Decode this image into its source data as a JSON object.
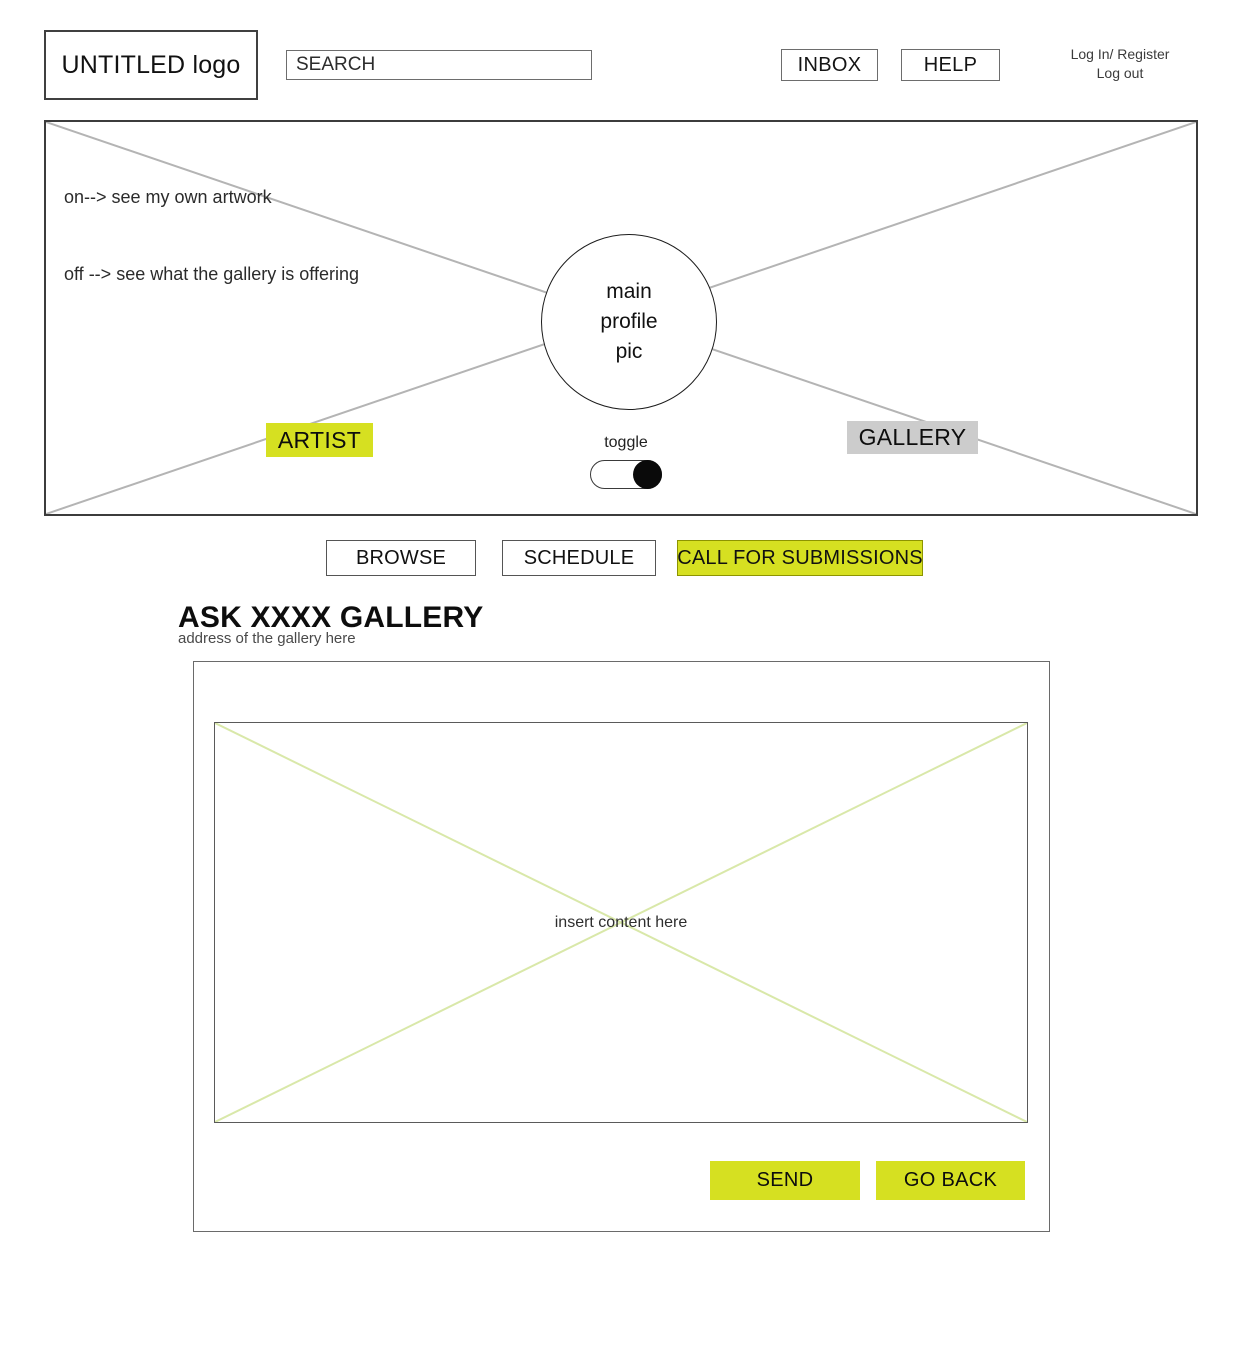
{
  "header": {
    "logo": "UNTITLED logo",
    "search": {
      "value": "SEARCH",
      "placeholder": "SEARCH"
    },
    "inbox_label": "INBOX",
    "help_label": "HELP",
    "account": {
      "login_register": "Log In/ Register",
      "logout": "Log out"
    }
  },
  "hero": {
    "note_line_1": "on--> see my own artwork",
    "note_line_2": "off --> see what the gallery is offering",
    "profile_pic": {
      "line_1": "main",
      "line_2": "profile",
      "line_3": "pic"
    },
    "artist_label": "ARTIST",
    "gallery_label": "GALLERY",
    "toggle_label": "toggle",
    "toggle_state": "on"
  },
  "nav_tabs": [
    {
      "id": "browse",
      "label": "BROWSE",
      "active": false
    },
    {
      "id": "schedule",
      "label": "SCHEDULE",
      "active": false
    },
    {
      "id": "call-for-submissions",
      "label": "CALL FOR SUBMISSIONS",
      "active": true
    }
  ],
  "section": {
    "title": "ASK XXXX GALLERY",
    "address": "address of the gallery here"
  },
  "content_panel": {
    "placeholder_text": "insert content here",
    "send_label": "SEND",
    "go_back_label": "GO BACK"
  },
  "colors": {
    "accent_yellow_green": "#d6e021",
    "muted_gray": "#cccccc",
    "cross_line_gray": "#b4b4b4",
    "cross_line_green": "#d9e8a9",
    "border_dark": "#3c3c3c"
  }
}
